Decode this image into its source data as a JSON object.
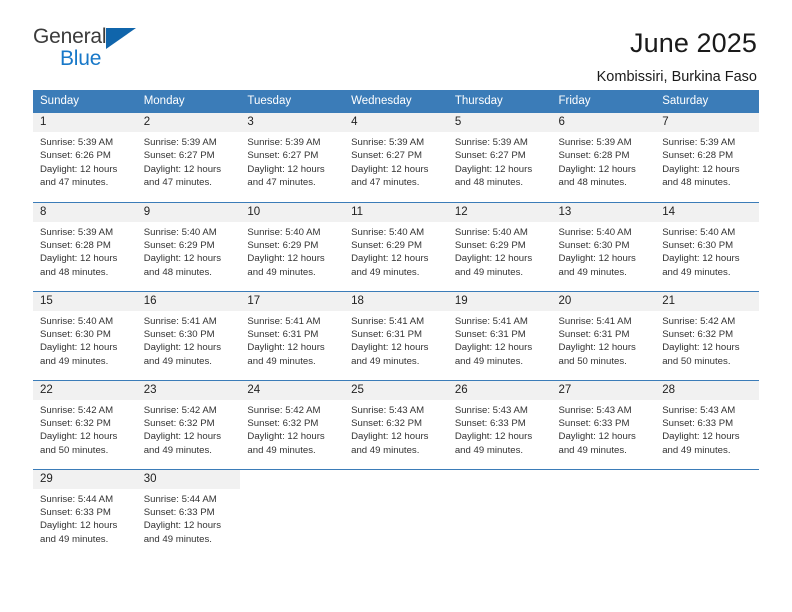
{
  "brand": {
    "name_part1": "General",
    "name_part2": "Blue",
    "triangle_color": "#1065ab",
    "blue_color": "#1878c8"
  },
  "header": {
    "title": "June 2025",
    "subtitle": "Kombissiri, Burkina Faso"
  },
  "theme": {
    "header_bg": "#3b7cb8",
    "header_text": "#ffffff",
    "daynum_bg": "#f1f1f1",
    "row_divider": "#3b7cb8",
    "body_text": "#333333"
  },
  "weekday_headers": [
    "Sunday",
    "Monday",
    "Tuesday",
    "Wednesday",
    "Thursday",
    "Friday",
    "Saturday"
  ],
  "weeks": [
    [
      {
        "day": "1",
        "sunrise": "Sunrise: 5:39 AM",
        "sunset": "Sunset: 6:26 PM",
        "daylight_1": "Daylight: 12 hours",
        "daylight_2": "and 47 minutes."
      },
      {
        "day": "2",
        "sunrise": "Sunrise: 5:39 AM",
        "sunset": "Sunset: 6:27 PM",
        "daylight_1": "Daylight: 12 hours",
        "daylight_2": "and 47 minutes."
      },
      {
        "day": "3",
        "sunrise": "Sunrise: 5:39 AM",
        "sunset": "Sunset: 6:27 PM",
        "daylight_1": "Daylight: 12 hours",
        "daylight_2": "and 47 minutes."
      },
      {
        "day": "4",
        "sunrise": "Sunrise: 5:39 AM",
        "sunset": "Sunset: 6:27 PM",
        "daylight_1": "Daylight: 12 hours",
        "daylight_2": "and 47 minutes."
      },
      {
        "day": "5",
        "sunrise": "Sunrise: 5:39 AM",
        "sunset": "Sunset: 6:27 PM",
        "daylight_1": "Daylight: 12 hours",
        "daylight_2": "and 48 minutes."
      },
      {
        "day": "6",
        "sunrise": "Sunrise: 5:39 AM",
        "sunset": "Sunset: 6:28 PM",
        "daylight_1": "Daylight: 12 hours",
        "daylight_2": "and 48 minutes."
      },
      {
        "day": "7",
        "sunrise": "Sunrise: 5:39 AM",
        "sunset": "Sunset: 6:28 PM",
        "daylight_1": "Daylight: 12 hours",
        "daylight_2": "and 48 minutes."
      }
    ],
    [
      {
        "day": "8",
        "sunrise": "Sunrise: 5:39 AM",
        "sunset": "Sunset: 6:28 PM",
        "daylight_1": "Daylight: 12 hours",
        "daylight_2": "and 48 minutes."
      },
      {
        "day": "9",
        "sunrise": "Sunrise: 5:40 AM",
        "sunset": "Sunset: 6:29 PM",
        "daylight_1": "Daylight: 12 hours",
        "daylight_2": "and 48 minutes."
      },
      {
        "day": "10",
        "sunrise": "Sunrise: 5:40 AM",
        "sunset": "Sunset: 6:29 PM",
        "daylight_1": "Daylight: 12 hours",
        "daylight_2": "and 49 minutes."
      },
      {
        "day": "11",
        "sunrise": "Sunrise: 5:40 AM",
        "sunset": "Sunset: 6:29 PM",
        "daylight_1": "Daylight: 12 hours",
        "daylight_2": "and 49 minutes."
      },
      {
        "day": "12",
        "sunrise": "Sunrise: 5:40 AM",
        "sunset": "Sunset: 6:29 PM",
        "daylight_1": "Daylight: 12 hours",
        "daylight_2": "and 49 minutes."
      },
      {
        "day": "13",
        "sunrise": "Sunrise: 5:40 AM",
        "sunset": "Sunset: 6:30 PM",
        "daylight_1": "Daylight: 12 hours",
        "daylight_2": "and 49 minutes."
      },
      {
        "day": "14",
        "sunrise": "Sunrise: 5:40 AM",
        "sunset": "Sunset: 6:30 PM",
        "daylight_1": "Daylight: 12 hours",
        "daylight_2": "and 49 minutes."
      }
    ],
    [
      {
        "day": "15",
        "sunrise": "Sunrise: 5:40 AM",
        "sunset": "Sunset: 6:30 PM",
        "daylight_1": "Daylight: 12 hours",
        "daylight_2": "and 49 minutes."
      },
      {
        "day": "16",
        "sunrise": "Sunrise: 5:41 AM",
        "sunset": "Sunset: 6:30 PM",
        "daylight_1": "Daylight: 12 hours",
        "daylight_2": "and 49 minutes."
      },
      {
        "day": "17",
        "sunrise": "Sunrise: 5:41 AM",
        "sunset": "Sunset: 6:31 PM",
        "daylight_1": "Daylight: 12 hours",
        "daylight_2": "and 49 minutes."
      },
      {
        "day": "18",
        "sunrise": "Sunrise: 5:41 AM",
        "sunset": "Sunset: 6:31 PM",
        "daylight_1": "Daylight: 12 hours",
        "daylight_2": "and 49 minutes."
      },
      {
        "day": "19",
        "sunrise": "Sunrise: 5:41 AM",
        "sunset": "Sunset: 6:31 PM",
        "daylight_1": "Daylight: 12 hours",
        "daylight_2": "and 49 minutes."
      },
      {
        "day": "20",
        "sunrise": "Sunrise: 5:41 AM",
        "sunset": "Sunset: 6:31 PM",
        "daylight_1": "Daylight: 12 hours",
        "daylight_2": "and 50 minutes."
      },
      {
        "day": "21",
        "sunrise": "Sunrise: 5:42 AM",
        "sunset": "Sunset: 6:32 PM",
        "daylight_1": "Daylight: 12 hours",
        "daylight_2": "and 50 minutes."
      }
    ],
    [
      {
        "day": "22",
        "sunrise": "Sunrise: 5:42 AM",
        "sunset": "Sunset: 6:32 PM",
        "daylight_1": "Daylight: 12 hours",
        "daylight_2": "and 50 minutes."
      },
      {
        "day": "23",
        "sunrise": "Sunrise: 5:42 AM",
        "sunset": "Sunset: 6:32 PM",
        "daylight_1": "Daylight: 12 hours",
        "daylight_2": "and 49 minutes."
      },
      {
        "day": "24",
        "sunrise": "Sunrise: 5:42 AM",
        "sunset": "Sunset: 6:32 PM",
        "daylight_1": "Daylight: 12 hours",
        "daylight_2": "and 49 minutes."
      },
      {
        "day": "25",
        "sunrise": "Sunrise: 5:43 AM",
        "sunset": "Sunset: 6:32 PM",
        "daylight_1": "Daylight: 12 hours",
        "daylight_2": "and 49 minutes."
      },
      {
        "day": "26",
        "sunrise": "Sunrise: 5:43 AM",
        "sunset": "Sunset: 6:33 PM",
        "daylight_1": "Daylight: 12 hours",
        "daylight_2": "and 49 minutes."
      },
      {
        "day": "27",
        "sunrise": "Sunrise: 5:43 AM",
        "sunset": "Sunset: 6:33 PM",
        "daylight_1": "Daylight: 12 hours",
        "daylight_2": "and 49 minutes."
      },
      {
        "day": "28",
        "sunrise": "Sunrise: 5:43 AM",
        "sunset": "Sunset: 6:33 PM",
        "daylight_1": "Daylight: 12 hours",
        "daylight_2": "and 49 minutes."
      }
    ],
    [
      {
        "day": "29",
        "sunrise": "Sunrise: 5:44 AM",
        "sunset": "Sunset: 6:33 PM",
        "daylight_1": "Daylight: 12 hours",
        "daylight_2": "and 49 minutes."
      },
      {
        "day": "30",
        "sunrise": "Sunrise: 5:44 AM",
        "sunset": "Sunset: 6:33 PM",
        "daylight_1": "Daylight: 12 hours",
        "daylight_2": "and 49 minutes."
      },
      {
        "day": "",
        "sunrise": "",
        "sunset": "",
        "daylight_1": "",
        "daylight_2": ""
      },
      {
        "day": "",
        "sunrise": "",
        "sunset": "",
        "daylight_1": "",
        "daylight_2": ""
      },
      {
        "day": "",
        "sunrise": "",
        "sunset": "",
        "daylight_1": "",
        "daylight_2": ""
      },
      {
        "day": "",
        "sunrise": "",
        "sunset": "",
        "daylight_1": "",
        "daylight_2": ""
      },
      {
        "day": "",
        "sunrise": "",
        "sunset": "",
        "daylight_1": "",
        "daylight_2": ""
      }
    ]
  ]
}
